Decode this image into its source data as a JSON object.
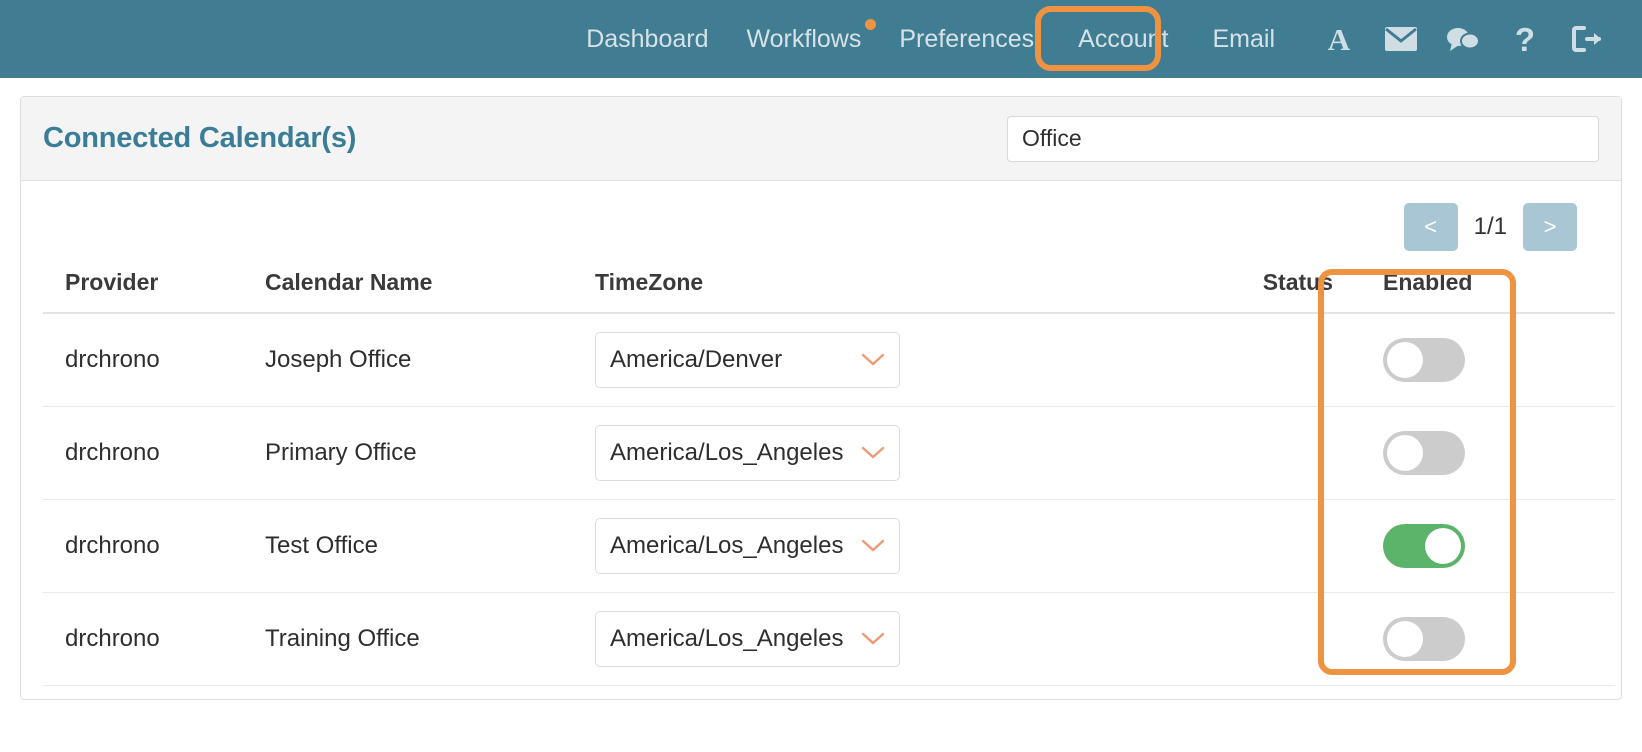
{
  "theme": {
    "header_bg": "#417d92",
    "accent_orange": "#ef9340",
    "title_teal": "#3a7d96",
    "toggle_on_green": "#5cb36a",
    "toggle_off_gray": "#cccccc",
    "pager_blue": "#a8c6d3"
  },
  "topnav": {
    "links": [
      {
        "label": "Dashboard",
        "badge": false,
        "highlighted": false
      },
      {
        "label": "Workflows",
        "badge": true,
        "highlighted": false
      },
      {
        "label": "Preferences",
        "badge": false,
        "highlighted": false
      },
      {
        "label": "Account",
        "badge": false,
        "highlighted": true
      },
      {
        "label": "Email",
        "badge": false,
        "highlighted": false
      }
    ],
    "icons": [
      {
        "name": "font-size-icon",
        "glyph": "A"
      },
      {
        "name": "envelope-icon",
        "glyph": "envelope"
      },
      {
        "name": "chat-bubbles-icon",
        "glyph": "chat"
      },
      {
        "name": "help-icon",
        "glyph": "?"
      },
      {
        "name": "logout-icon",
        "glyph": "logout"
      }
    ]
  },
  "card": {
    "title": "Connected Calendar(s)",
    "search": {
      "value": "Office",
      "placeholder": ""
    },
    "pager": {
      "prev_label": "<",
      "next_label": ">",
      "page_label": "1/1"
    },
    "table": {
      "headers": [
        "Provider",
        "Calendar Name",
        "TimeZone",
        "Status",
        "Enabled"
      ],
      "rows": [
        {
          "provider": "drchrono",
          "calendar_name": "Joseph Office",
          "timezone": "America/Denver",
          "status": "",
          "enabled": false
        },
        {
          "provider": "drchrono",
          "calendar_name": "Primary Office",
          "timezone": "America/Los_Angeles",
          "status": "",
          "enabled": false
        },
        {
          "provider": "drchrono",
          "calendar_name": "Test Office",
          "timezone": "America/Los_Angeles",
          "status": "",
          "enabled": true
        },
        {
          "provider": "drchrono",
          "calendar_name": "Training Office",
          "timezone": "America/Los_Angeles",
          "status": "",
          "enabled": false
        }
      ]
    }
  }
}
